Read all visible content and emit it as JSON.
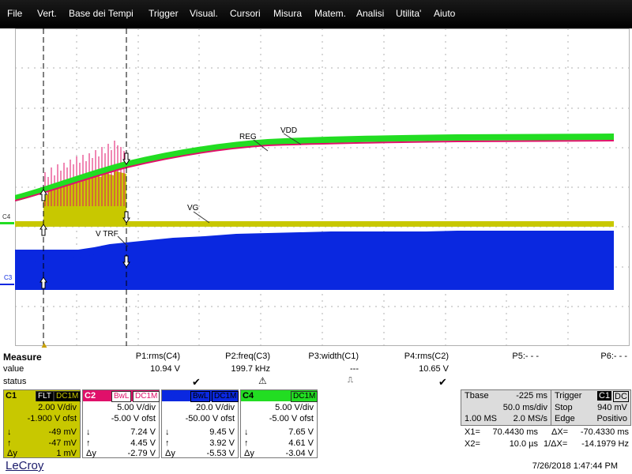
{
  "menu": [
    "File",
    "Vert.",
    "Base dei Tempi",
    "Trigger",
    "Visual.",
    "Cursori",
    "Misura",
    "Matem.",
    "Analisi",
    "Utilita'",
    "Aiuto"
  ],
  "traces": {
    "labels": {
      "reg": "REG",
      "vdd": "VDD",
      "vg": "VG",
      "vtrf": "V TRF"
    },
    "markers": {
      "c4": "C4",
      "c3": "C3"
    },
    "colors": {
      "c1": "#c8c800",
      "c2": "#e0106a",
      "c3": "#0a28e0",
      "c4": "#22dd22",
      "grid": "#b0b0b0"
    }
  },
  "measure": {
    "header": "Measure",
    "row_value": "value",
    "row_status": "status",
    "columns": [
      {
        "name": "P1:rms(C4)",
        "value": "10.94 V",
        "status": "check"
      },
      {
        "name": "P2:freq(C3)",
        "value": "199.7 kHz",
        "status": "warn"
      },
      {
        "name": "P3:width(C1)",
        "value": "---",
        "status": "pulse"
      },
      {
        "name": "P4:rms(C2)",
        "value": "10.65 V",
        "status": "check"
      },
      {
        "name": "P5:- - -",
        "value": "",
        "status": ""
      },
      {
        "name": "P6:- - -",
        "value": "",
        "status": ""
      }
    ]
  },
  "channels": [
    {
      "id": "C1",
      "tags": [
        "FLT",
        "DC1M"
      ],
      "vdiv": "2.00 V/div",
      "ofst": "-1.900 V ofst",
      "down": "-49 mV",
      "up": "-47 mV",
      "dy": "1 mV",
      "color": "#c8c800",
      "textcolor": "#000"
    },
    {
      "id": "C2",
      "tags": [
        "BwL",
        "DC1M"
      ],
      "vdiv": "5.00 V/div",
      "ofst": "-5.00 V ofst",
      "down": "7.24 V",
      "up": "4.45 V",
      "dy": "-2.79 V",
      "color": "#e0106a",
      "textcolor": "#fff"
    },
    {
      "id": "C3",
      "tags": [
        "BwL",
        "DC1M"
      ],
      "vdiv": "20.0 V/div",
      "ofst": "-50.00 V ofst",
      "down": "9.45 V",
      "up": "3.92 V",
      "dy": "-5.53 V",
      "color": "#0a28e0",
      "textcolor": "#fff"
    },
    {
      "id": "C4",
      "tags": [
        "DC1M"
      ],
      "vdiv": "5.00 V/div",
      "ofst": "-5.00 V ofst",
      "down": "7.65 V",
      "up": "4.61 V",
      "dy": "-3.04 V",
      "color": "#22dd22",
      "textcolor": "#000"
    }
  ],
  "timebase": {
    "label": "Tbase",
    "value": "-225 ms",
    "tdiv": "50.0 ms/div",
    "samples": "1.00 MS",
    "rate": "2.0 MS/s"
  },
  "trigger": {
    "label": "Trigger",
    "ch": "C1",
    "coupling": "DC",
    "mode": "Stop",
    "level": "940 mV",
    "type": "Edge",
    "slope": "Positivo"
  },
  "cursors": {
    "x1_label": "X1=",
    "x1": "70.4430 ms",
    "dx_label": "ΔX=",
    "dx": "-70.4330 ms",
    "x2_label": "X2=",
    "x2": "10.0 µs",
    "inv_label": "1/ΔX=",
    "inv": "-14.1979 Hz"
  },
  "brand": "LeCroy",
  "timestamp": "7/26/2018 1:47:44 PM"
}
